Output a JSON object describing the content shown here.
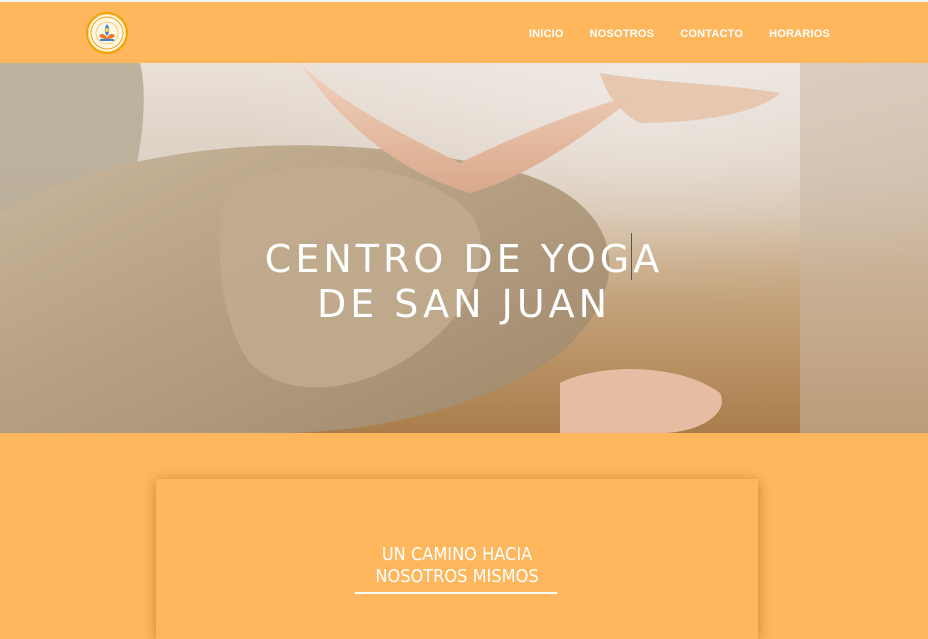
{
  "nav": {
    "logo_icon": "lotus-logo-icon",
    "links": [
      "INICIO",
      "NOSOTROS",
      "CONTACTO",
      "HORARIOS"
    ]
  },
  "hero": {
    "title_line1": "CENTRO DE YOGA",
    "title_line2": "DE SAN JUAN"
  },
  "card": {
    "heading_line1": "UN CAMINO HACIA",
    "heading_line2": "NOSOTROS MISMOS"
  },
  "colors": {
    "brand_orange": "#ffb75e",
    "text_white": "#ffffff"
  }
}
